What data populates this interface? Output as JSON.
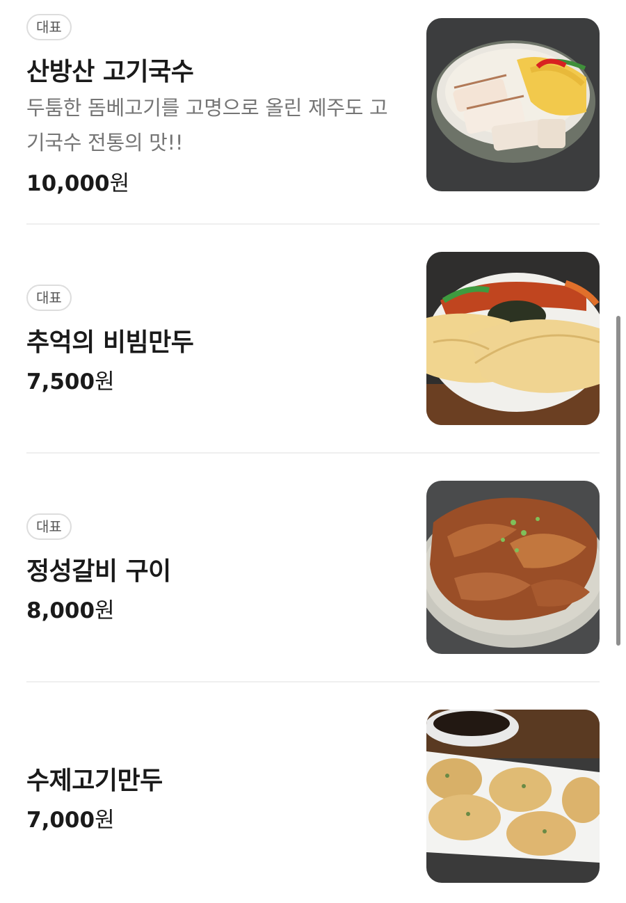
{
  "menu": {
    "items": [
      {
        "badge": "대표",
        "name": "산방산 고기국수",
        "description": "두툼한 돔베고기를 고명으로 올린 제주도 고기국수 전통의 맛!!",
        "price": "10,000",
        "currency": "원",
        "photo_icon": "noodle-soup-photo"
      },
      {
        "badge": "대표",
        "name": "추억의 비빔만두",
        "price": "7,500",
        "currency": "원",
        "photo_icon": "bibim-mandu-photo"
      },
      {
        "badge": "대표",
        "name": "정성갈비 구이",
        "price": "8,000",
        "currency": "원",
        "photo_icon": "grilled-galbi-photo"
      },
      {
        "name": "수제고기만두",
        "price": "7,000",
        "currency": "원",
        "photo_icon": "dumplings-photo"
      }
    ]
  },
  "colors": {
    "text": "#1a1a1a",
    "description": "#757575",
    "badge_border": "#dddddd",
    "divider": "#efefef",
    "scrollbar": "#8e8e8e"
  }
}
